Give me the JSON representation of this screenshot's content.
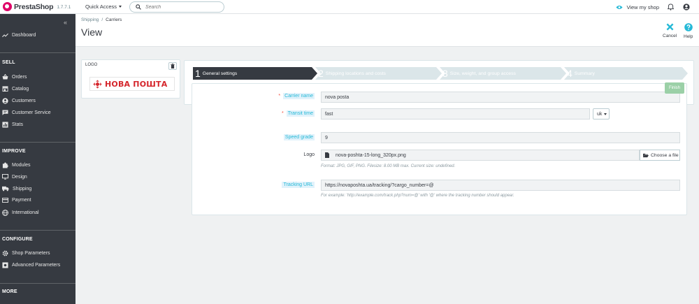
{
  "header": {
    "brand": "PrestaShop",
    "version": "1.7.7.1",
    "quick_access": "Quick Access",
    "search_placeholder": "Search",
    "view_shop": "View my shop"
  },
  "sidebar": {
    "collapse_label": "«",
    "dashboard": "Dashboard",
    "sections": [
      {
        "title": "SELL",
        "items": [
          "Orders",
          "Catalog",
          "Customers",
          "Customer Service",
          "Stats"
        ]
      },
      {
        "title": "IMPROVE",
        "items": [
          "Modules",
          "Design",
          "Shipping",
          "Payment",
          "International"
        ]
      },
      {
        "title": "CONFIGURE",
        "items": [
          "Shop Parameters",
          "Advanced Parameters"
        ]
      },
      {
        "title": "MORE",
        "items": []
      }
    ]
  },
  "page": {
    "breadcrumb": [
      "Shipping",
      "Carriers"
    ],
    "title": "View",
    "tools": [
      {
        "label": "Cancel",
        "icon": "close-icon",
        "color": "#25b9d7"
      },
      {
        "label": "Help",
        "icon": "help-icon",
        "color": "#25b9d7"
      }
    ]
  },
  "logo_card": {
    "label": "LOGO",
    "image_text": "НОВА ПОШТА",
    "brand_color": "#d5262c"
  },
  "wizard": {
    "steps": [
      {
        "num": "1",
        "label": "General settings",
        "active": true
      },
      {
        "num": "2",
        "label": "Shipping locations and costs",
        "active": false
      },
      {
        "num": "3",
        "label": "Size, weight, and group access",
        "active": false
      },
      {
        "num": "4",
        "label": "Summary",
        "active": false
      }
    ],
    "finish_label": "Finish"
  },
  "form": {
    "carrier_name": {
      "label": "Carrier name",
      "required": true,
      "value": "nova posta"
    },
    "transit_time": {
      "label": "Transit time",
      "required": true,
      "value": "fast",
      "lang": "uk"
    },
    "speed_grade": {
      "label": "Speed grade",
      "value": "9"
    },
    "logo": {
      "label": "Logo",
      "filename": "nova-poshta-15-long_320px.png",
      "button": "Choose a file",
      "help": "Format: JPG, GIF, PNG. Filesize: 8.00 MB max. Current size: undefined."
    },
    "tracking_url": {
      "label": "Tracking URL",
      "value": "https://novaposhta.ua/tracking/?cargo_number=@",
      "help": "For example: 'http://example.com/track.php?num=@' with '@' where the tracking number should appear."
    }
  },
  "colors": {
    "sidebar_bg": "#363a41",
    "accent": "#25b9d7",
    "step_active": "#363a41",
    "step_inactive": "#bbcdd2",
    "finish": "#9bd0a7",
    "required": "#f54c3e"
  }
}
